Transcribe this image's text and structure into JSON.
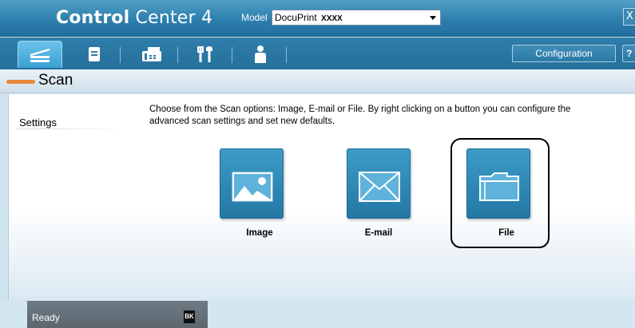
{
  "app": {
    "title_bold": "Control",
    "title_light": " Center 4",
    "close_label": "X"
  },
  "model": {
    "label": "Model",
    "selected_prefix": "DocuPrint",
    "selected_suffix": "XXXX"
  },
  "toolbar": {
    "tabs": [
      {
        "icon": "scan-icon",
        "active": true
      },
      {
        "icon": "document-icon",
        "active": false
      },
      {
        "icon": "fax-icon",
        "active": false
      },
      {
        "icon": "device-settings-icon",
        "active": false
      },
      {
        "icon": "user-icon",
        "active": false
      }
    ],
    "configuration_label": "Configuration",
    "help_label": "?"
  },
  "section": {
    "title": "Scan"
  },
  "sidebar": {
    "settings_label": "Settings"
  },
  "main": {
    "instructions": "Choose from the Scan options: Image, E-mail or File. By right clicking on a button you can configure the advanced scan settings and set new defaults.",
    "buttons": [
      {
        "label": "Image",
        "icon": "image-icon"
      },
      {
        "label": "E-mail",
        "icon": "envelope-icon"
      },
      {
        "label": "File",
        "icon": "folder-icon",
        "highlighted": true
      }
    ]
  },
  "status": {
    "text": "Ready",
    "ink_label": "BK"
  },
  "colors": {
    "titlebar": "#2e7fae",
    "accent": "#e88a3a",
    "button_blue": "#2d86b2"
  }
}
